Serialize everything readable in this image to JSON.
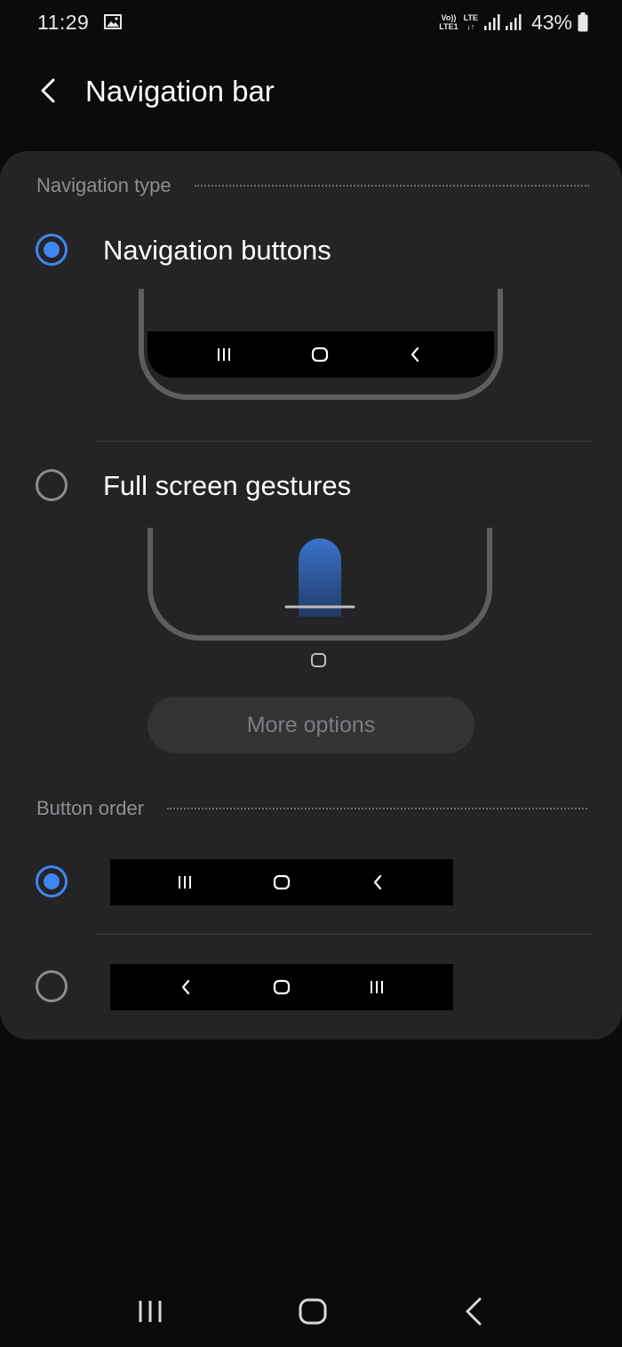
{
  "status_bar": {
    "time": "11:29",
    "volte_top": "Vo))",
    "volte_bottom": "LTE1",
    "lte": "LTE",
    "battery": "43%",
    "icons": [
      "gallery-icon",
      "signal-icon",
      "signal-icon",
      "battery-icon"
    ]
  },
  "header": {
    "title": "Navigation bar"
  },
  "navigation_type": {
    "section_title": "Navigation type",
    "options": [
      {
        "label": "Navigation buttons",
        "selected": true
      },
      {
        "label": "Full screen gestures",
        "selected": false
      }
    ],
    "more_options_label": "More options"
  },
  "button_order": {
    "section_title": "Button order",
    "options": [
      {
        "selected": true,
        "buttons": [
          "recents-icon",
          "home-icon",
          "back-icon"
        ]
      },
      {
        "selected": false,
        "buttons": [
          "back-icon",
          "home-icon",
          "recents-icon"
        ]
      }
    ]
  },
  "colors": {
    "accent": "#3f86f0",
    "card": "#242426",
    "background": "#0b0b0c"
  }
}
